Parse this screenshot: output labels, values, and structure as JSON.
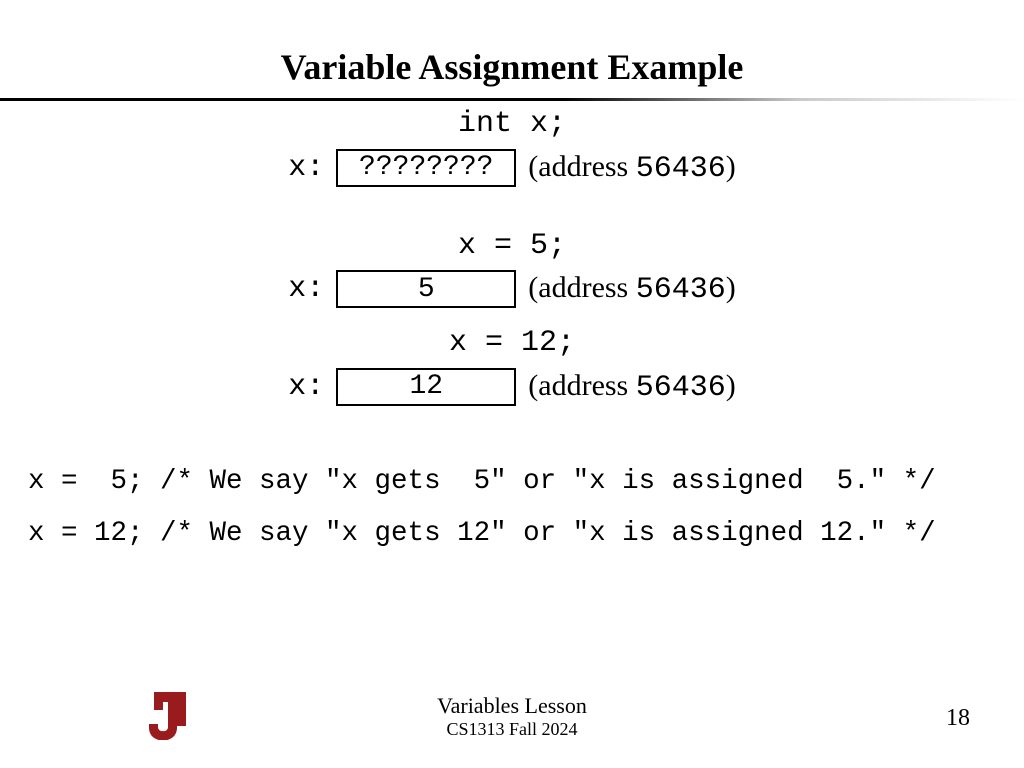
{
  "title": "Variable Assignment Example",
  "blocks": [
    {
      "code": "int x;",
      "var": "x",
      "box": "????????",
      "addr_label": "address",
      "addr_value": "56436"
    },
    {
      "code": "x = 5;",
      "var": "x",
      "box": "5",
      "addr_label": "address",
      "addr_value": "56436"
    },
    {
      "code": "x = 12;",
      "var": "x",
      "box": "12",
      "addr_label": "address",
      "addr_value": "56436"
    }
  ],
  "comments": {
    "line1": "x =  5; /* We say \"x gets  5\" or \"x is assigned  5.\" */",
    "line2": "x = 12; /* We say \"x gets 12\" or \"x is assigned 12.\" */"
  },
  "footer": {
    "lesson": "Variables Lesson",
    "course": "CS1313 Fall 2024",
    "page": "18"
  }
}
